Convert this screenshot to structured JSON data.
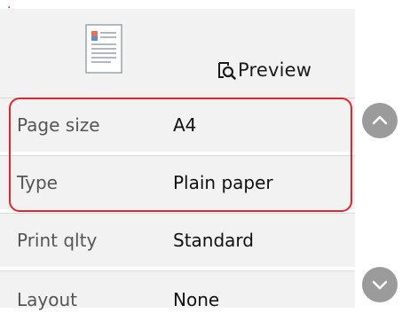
{
  "preview": {
    "label": "Preview",
    "icon": "preview-magnifier-icon"
  },
  "settings": [
    {
      "label": "Page size",
      "value": "A4"
    },
    {
      "label": "Type",
      "value": "Plain paper"
    },
    {
      "label": "Print qlty",
      "value": "Standard"
    },
    {
      "label": "Layout",
      "value": "None"
    }
  ],
  "scroll": {
    "up_icon": "chevron-up-icon",
    "down_icon": "chevron-down-icon"
  },
  "colors": {
    "highlight": "#e0262b",
    "panel": "#f2f2f2",
    "scroll_button": "#9b9b9b"
  }
}
